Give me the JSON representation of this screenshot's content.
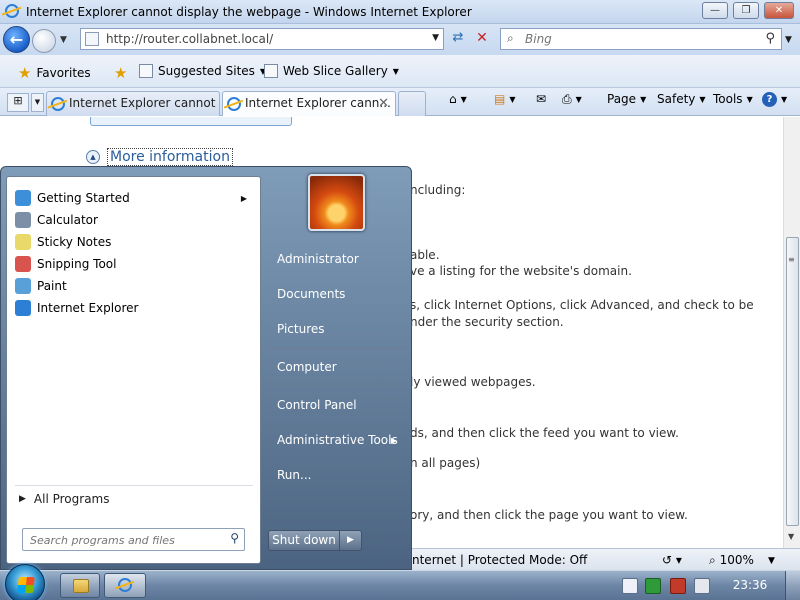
{
  "window": {
    "title": "Internet Explorer cannot display the webpage - Windows Internet Explorer",
    "min": "—",
    "max": "❐",
    "close": "✕"
  },
  "address": {
    "url": "http://router.collabnet.local/",
    "search_placeholder": "Bing"
  },
  "favorites_bar": {
    "favorites": "Favorites",
    "suggested_sites": "Suggested Sites",
    "web_slice_gallery": "Web Slice Gallery"
  },
  "tabs": [
    {
      "label": "Internet Explorer cannot d..."
    },
    {
      "label": "Internet Explorer cann..."
    }
  ],
  "command_bar": {
    "page": "Page",
    "safety": "Safety",
    "tools": "Tools"
  },
  "content": {
    "more_information": "More information",
    "lines": [
      "ncluding:",
      "able.",
      "ve a listing for the website's domain.",
      "s, click Internet Options, click Advanced, and check to be",
      "nder the security section.",
      "ly viewed webpages.",
      "ds, and then click the feed you want to view.",
      "n all pages)",
      "ory, and then click the page you want to view."
    ]
  },
  "statusbar": {
    "zone": "nternet | Protected Mode: Off",
    "zoom": "100%"
  },
  "start_menu": {
    "programs": [
      {
        "label": "Getting Started",
        "icon": "getting-started-icon",
        "color": "#3c8fd8",
        "submenu": true
      },
      {
        "label": "Calculator",
        "icon": "calculator-icon",
        "color": "#7c8fa6",
        "submenu": false
      },
      {
        "label": "Sticky Notes",
        "icon": "sticky-notes-icon",
        "color": "#e8d96a",
        "submenu": false
      },
      {
        "label": "Snipping Tool",
        "icon": "snipping-tool-icon",
        "color": "#d9534f",
        "submenu": false
      },
      {
        "label": "Paint",
        "icon": "paint-icon",
        "color": "#5aa0d8",
        "submenu": false
      },
      {
        "label": "Internet Explorer",
        "icon": "internet-explorer-icon",
        "color": "#2d7fd6",
        "submenu": false
      }
    ],
    "all_programs": "All Programs",
    "search_placeholder": "Search programs and files",
    "right_links": [
      {
        "label": "Administrator",
        "submenu": false
      },
      {
        "label": "Documents",
        "submenu": false
      },
      {
        "label": "Pictures",
        "submenu": false
      },
      {
        "label": "Computer",
        "submenu": false
      },
      {
        "label": "Control Panel",
        "submenu": false
      },
      {
        "label": "Administrative Tools",
        "submenu": true
      },
      {
        "label": "Run...",
        "submenu": false
      }
    ],
    "shutdown": "Shut down"
  },
  "taskbar": {
    "clock": "23:36"
  }
}
